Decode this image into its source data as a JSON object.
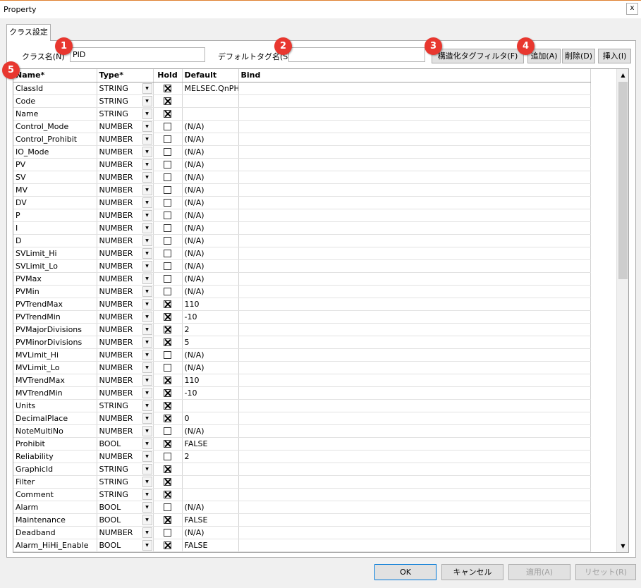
{
  "window": {
    "title": "Property",
    "close_label": "x"
  },
  "tab": {
    "label": "クラス設定"
  },
  "class_name": {
    "label": "クラス名(N)",
    "value": "PID"
  },
  "default_tag": {
    "label": "デフォルトタグ名(S)",
    "value": ""
  },
  "toolbar": {
    "filter_label": "構造化タグフィルタ(F)",
    "add_label": "追加(A)",
    "delete_label": "削除(D)",
    "insert_label": "挿入(I)"
  },
  "badges": [
    "1",
    "2",
    "3",
    "4",
    "5"
  ],
  "grid": {
    "headers": [
      "Name*",
      "Type*",
      "Hold",
      "Default",
      "Bind"
    ],
    "rows": [
      {
        "name": "ClassId",
        "type": "STRING",
        "hold": true,
        "default": "MELSEC.QnPH.PID"
      },
      {
        "name": "Code",
        "type": "STRING",
        "hold": true,
        "default": ""
      },
      {
        "name": "Name",
        "type": "STRING",
        "hold": true,
        "default": ""
      },
      {
        "name": "Control_Mode",
        "type": "NUMBER",
        "hold": false,
        "default": "(N/A)"
      },
      {
        "name": "Control_Prohibit",
        "type": "NUMBER",
        "hold": false,
        "default": "(N/A)"
      },
      {
        "name": "IO_Mode",
        "type": "NUMBER",
        "hold": false,
        "default": "(N/A)"
      },
      {
        "name": "PV",
        "type": "NUMBER",
        "hold": false,
        "default": "(N/A)"
      },
      {
        "name": "SV",
        "type": "NUMBER",
        "hold": false,
        "default": "(N/A)"
      },
      {
        "name": "MV",
        "type": "NUMBER",
        "hold": false,
        "default": "(N/A)"
      },
      {
        "name": "DV",
        "type": "NUMBER",
        "hold": false,
        "default": "(N/A)"
      },
      {
        "name": "P",
        "type": "NUMBER",
        "hold": false,
        "default": "(N/A)"
      },
      {
        "name": "I",
        "type": "NUMBER",
        "hold": false,
        "default": "(N/A)"
      },
      {
        "name": "D",
        "type": "NUMBER",
        "hold": false,
        "default": "(N/A)"
      },
      {
        "name": "SVLimit_Hi",
        "type": "NUMBER",
        "hold": false,
        "default": "(N/A)"
      },
      {
        "name": "SVLimit_Lo",
        "type": "NUMBER",
        "hold": false,
        "default": "(N/A)"
      },
      {
        "name": "PVMax",
        "type": "NUMBER",
        "hold": false,
        "default": "(N/A)"
      },
      {
        "name": "PVMin",
        "type": "NUMBER",
        "hold": false,
        "default": "(N/A)"
      },
      {
        "name": "PVTrendMax",
        "type": "NUMBER",
        "hold": true,
        "default": "110"
      },
      {
        "name": "PVTrendMin",
        "type": "NUMBER",
        "hold": true,
        "default": "-10"
      },
      {
        "name": "PVMajorDivisions",
        "type": "NUMBER",
        "hold": true,
        "default": "2"
      },
      {
        "name": "PVMinorDivisions",
        "type": "NUMBER",
        "hold": true,
        "default": "5"
      },
      {
        "name": "MVLimit_Hi",
        "type": "NUMBER",
        "hold": false,
        "default": "(N/A)"
      },
      {
        "name": "MVLimit_Lo",
        "type": "NUMBER",
        "hold": false,
        "default": "(N/A)"
      },
      {
        "name": "MVTrendMax",
        "type": "NUMBER",
        "hold": true,
        "default": "110"
      },
      {
        "name": "MVTrendMin",
        "type": "NUMBER",
        "hold": true,
        "default": "-10"
      },
      {
        "name": "Units",
        "type": "STRING",
        "hold": true,
        "default": ""
      },
      {
        "name": "DecimalPlace",
        "type": "NUMBER",
        "hold": true,
        "default": "0"
      },
      {
        "name": "NoteMultiNo",
        "type": "NUMBER",
        "hold": false,
        "default": "(N/A)"
      },
      {
        "name": "Prohibit",
        "type": "BOOL",
        "hold": true,
        "default": "FALSE"
      },
      {
        "name": "Reliability",
        "type": "NUMBER",
        "hold": false,
        "default": "2"
      },
      {
        "name": "GraphicId",
        "type": "STRING",
        "hold": true,
        "default": ""
      },
      {
        "name": "Filter",
        "type": "STRING",
        "hold": true,
        "default": ""
      },
      {
        "name": "Comment",
        "type": "STRING",
        "hold": true,
        "default": ""
      },
      {
        "name": "Alarm",
        "type": "BOOL",
        "hold": false,
        "default": "(N/A)"
      },
      {
        "name": "Maintenance",
        "type": "BOOL",
        "hold": true,
        "default": "FALSE"
      },
      {
        "name": "Deadband",
        "type": "NUMBER",
        "hold": false,
        "default": "(N/A)"
      },
      {
        "name": "Alarm_HiHi_Enable",
        "type": "BOOL",
        "hold": true,
        "default": "FALSE"
      }
    ]
  },
  "footer": {
    "ok_label": "OK",
    "cancel_label": "キャンセル",
    "apply_label": "適用(A)",
    "reset_label": "リセット(R)"
  }
}
